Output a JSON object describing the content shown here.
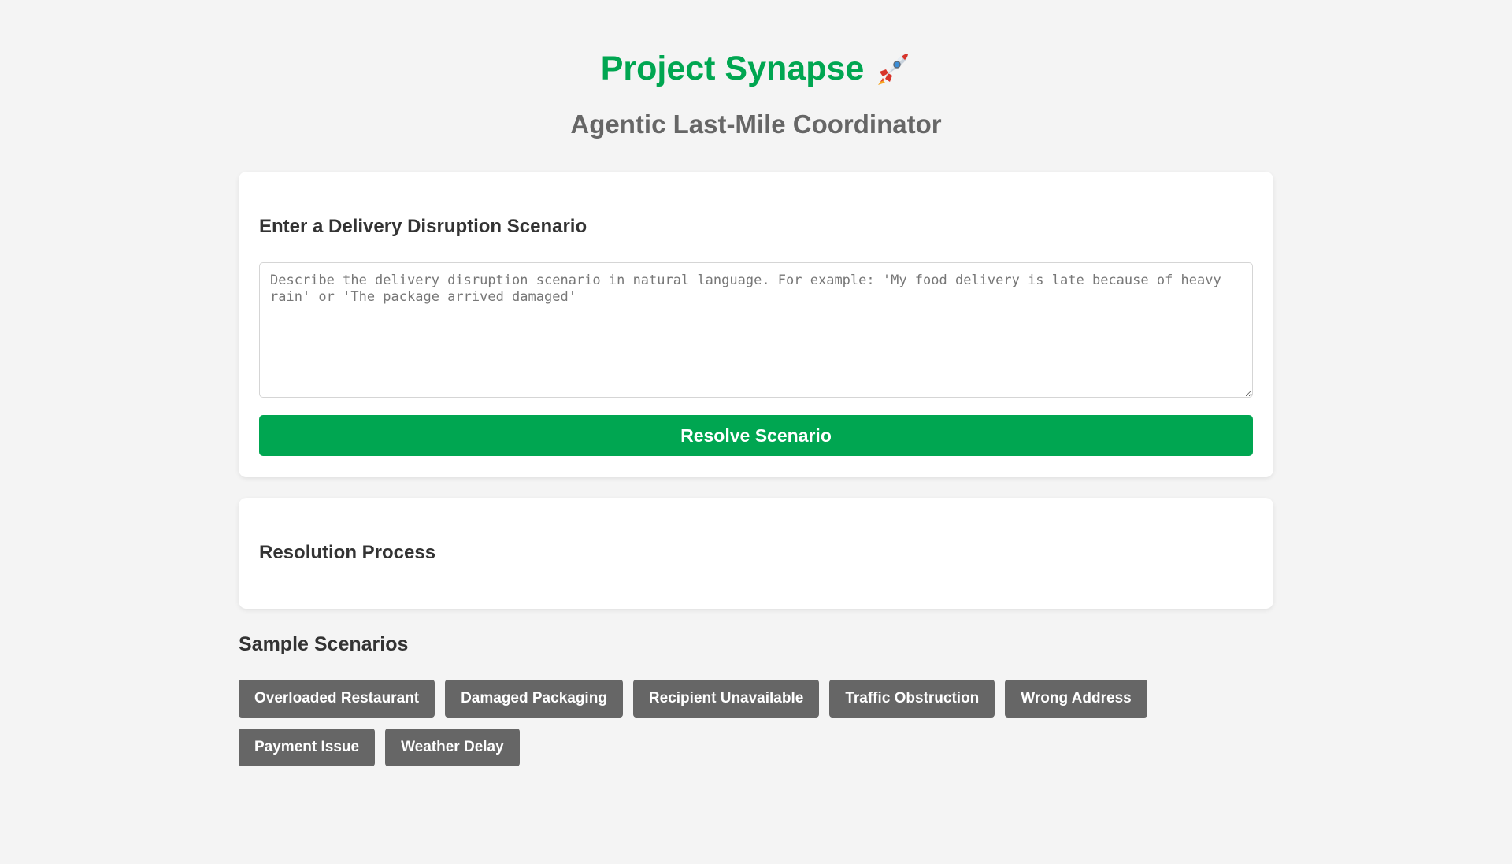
{
  "header": {
    "title": "Project Synapse",
    "title_icon": "rocket-icon",
    "subtitle": "Agentic Last-Mile Coordinator"
  },
  "input_card": {
    "heading": "Enter a Delivery Disruption Scenario",
    "textarea_value": "",
    "textarea_placeholder": "Describe the delivery disruption scenario in natural language. For example: 'My food delivery is late because of heavy rain' or 'The package arrived damaged'",
    "resolve_label": "Resolve Scenario"
  },
  "resolution_card": {
    "heading": "Resolution Process"
  },
  "samples": {
    "heading": "Sample Scenarios",
    "items": [
      {
        "label": "Overloaded Restaurant"
      },
      {
        "label": "Damaged Packaging"
      },
      {
        "label": "Recipient Unavailable"
      },
      {
        "label": "Traffic Obstruction"
      },
      {
        "label": "Wrong Address"
      },
      {
        "label": "Payment Issue"
      },
      {
        "label": "Weather Delay"
      }
    ]
  },
  "colors": {
    "accent": "#00a651",
    "subtitle": "#666666",
    "sample_button": "#666666",
    "background": "#f4f4f4"
  }
}
